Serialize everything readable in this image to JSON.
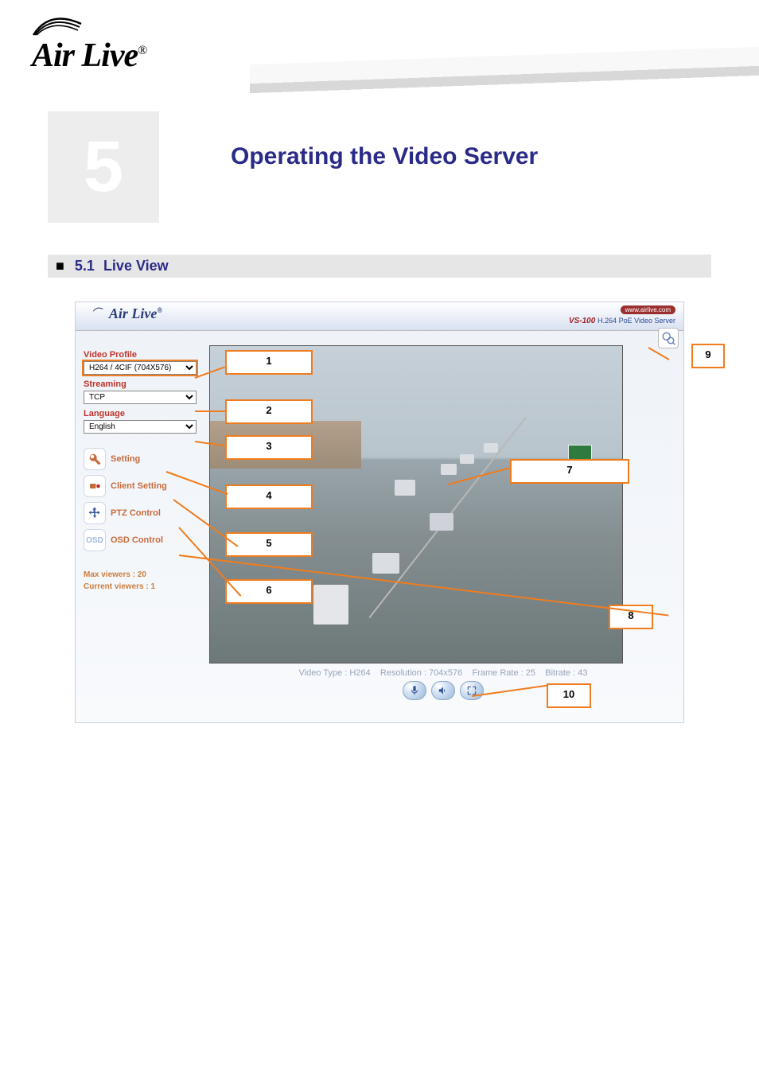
{
  "header": {
    "logo_text": "Air Live"
  },
  "chapter": {
    "number": "5",
    "title": "Operating the Video Server"
  },
  "section": {
    "number": "5.1",
    "title": "Live View"
  },
  "screenshot": {
    "top": {
      "logo": "Air Live",
      "url_badge": "www.airlive.com",
      "model": "VS-100",
      "model_sub": "H.264 PoE Video Server"
    },
    "side": {
      "video_profile_label": "Video Profile",
      "video_profile_value": "H264 / 4CIF (704X576)",
      "streaming_label": "Streaming",
      "streaming_value": "TCP",
      "language_label": "Language",
      "language_value": "English",
      "btn_setting": "Setting",
      "btn_client": "Client Setting",
      "btn_ptz": "PTZ Control",
      "btn_osd": "OSD Control",
      "osd_icon_text": "OSD",
      "max_viewers": "Max viewers : 20",
      "current_viewers": "Current viewers : 1"
    },
    "info_line": {
      "video_type_label": "Video Type :",
      "video_type": "H264",
      "resolution_label": "Resolution :",
      "resolution": "704x576",
      "frame_rate_label": "Frame Rate :",
      "frame_rate": "25",
      "bitrate_label": "Bitrate :",
      "bitrate": "43"
    }
  },
  "callouts": {
    "c1": "1",
    "c2": "2",
    "c3": "3",
    "c4": "4",
    "c5": "5",
    "c6": "6",
    "c7": "7",
    "c8": "8",
    "c9": "9",
    "c10": "10"
  }
}
